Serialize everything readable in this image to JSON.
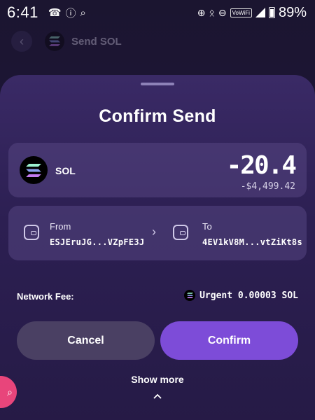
{
  "status_bar": {
    "time": "6:41",
    "volte": "VoWiFi",
    "battery": "89%"
  },
  "underlay": {
    "title": "Send SOL"
  },
  "sheet": {
    "title": "Confirm Send",
    "token": {
      "symbol": "SOL",
      "amount": "-20.4",
      "usd_value": "-$4,499.42"
    },
    "route": {
      "from_label": "From",
      "from_address": "ESJEruJG...VZpFE3J",
      "to_label": "To",
      "to_address": "4EV1kV8M...vtZiKt8s"
    },
    "fee": {
      "label": "Network Fee:",
      "value": "Urgent 0.00003 SOL"
    },
    "buttons": {
      "cancel": "Cancel",
      "confirm": "Confirm"
    },
    "show_more": "Show more"
  },
  "colors": {
    "accent": "#7d4cd8",
    "cancel_bg": "#4a4063",
    "fab": "#e8457b"
  }
}
